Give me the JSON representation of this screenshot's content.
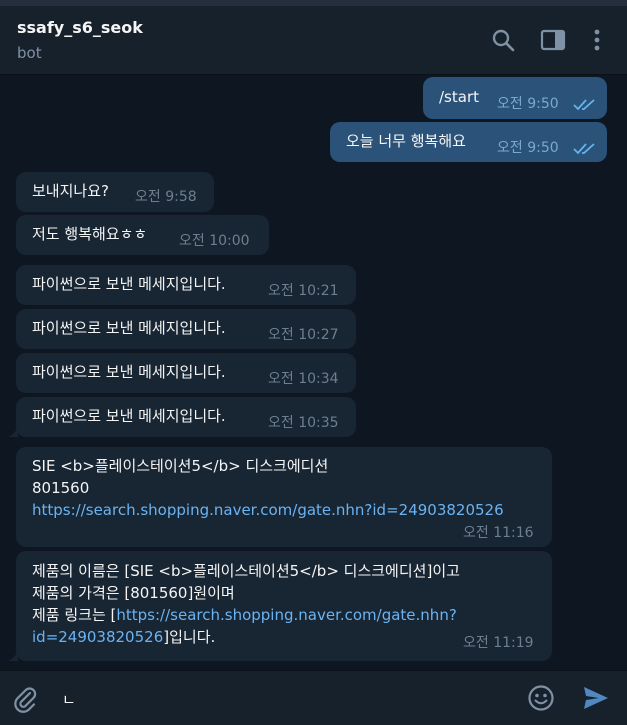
{
  "header": {
    "title": "ssafy_s6_seok",
    "subtitle": "bot"
  },
  "messages": [
    {
      "dir": "out",
      "text": "/start",
      "time": "오전 9:50"
    },
    {
      "dir": "out",
      "text": "오늘 너무 행복해요",
      "time": "오전 9:50"
    },
    {
      "dir": "in",
      "text": "보내지나요?",
      "time": "오전 9:58"
    },
    {
      "dir": "in",
      "text": "저도 행복해요ㅎㅎ",
      "time": "오전 10:00"
    },
    {
      "dir": "in",
      "text": "파이썬으로 보낸 메세지입니다.",
      "time": "오전 10:21"
    },
    {
      "dir": "in",
      "text": "파이썬으로 보낸 메세지입니다.",
      "time": "오전 10:27"
    },
    {
      "dir": "in",
      "text": "파이썬으로 보낸 메세지입니다.",
      "time": "오전 10:34"
    },
    {
      "dir": "in",
      "text": "파이썬으로 보낸 메세지입니다.",
      "time": "오전 10:35"
    },
    {
      "dir": "in",
      "lines": [
        "SIE <b>플레이스테이션5</b> 디스크에디션",
        "801560"
      ],
      "link": "https://search.shopping.naver.com/gate.nhn?id=24903820526",
      "time": "오전 11:16"
    },
    {
      "dir": "in",
      "line1": "제품의 이름은 [SIE <b>플레이스테이션5</b> 디스크에디션]이고",
      "line2": "제품의 가격은 [801560]원이며",
      "line3_prefix": "제품 링크는 [",
      "line3_link": "https://search.shopping.naver.com/gate.nhn?",
      "line4_link": "id=24903820526",
      "line4_suffix": "]입니다.",
      "time": "오전 11:19"
    }
  ],
  "composer": {
    "value": "ㄴ"
  },
  "icons": {
    "search": "search-icon",
    "sidebar": "sidebar-toggle-icon",
    "menu": "more-vertical-icon",
    "attach": "paperclip-icon",
    "emoji": "emoji-icon",
    "send": "send-icon"
  },
  "colors": {
    "background": "#0e1621",
    "header": "#17212b",
    "outgoing_bubble": "#2b5278",
    "incoming_bubble": "#182533",
    "link": "#6ab3f3",
    "read_ticks": "#64b5ef"
  }
}
